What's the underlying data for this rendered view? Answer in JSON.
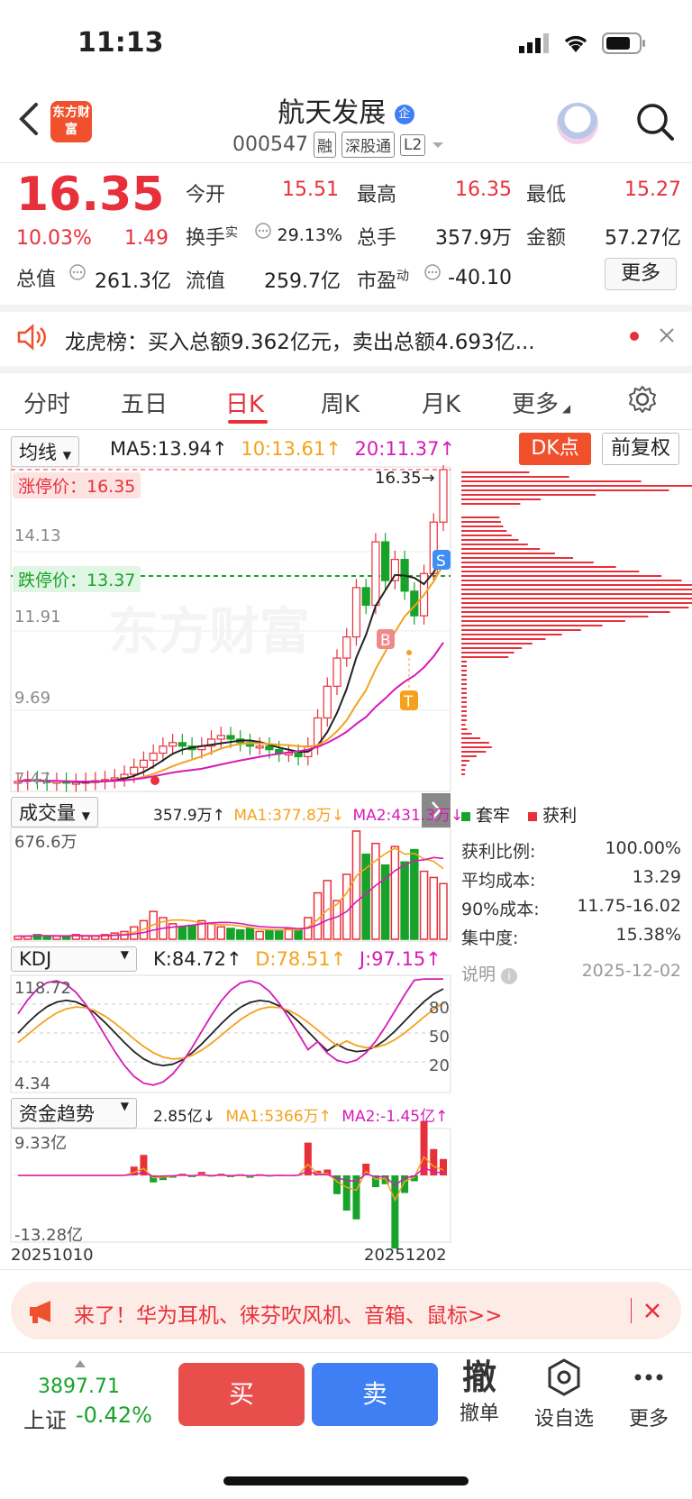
{
  "status": {
    "time": "11:13"
  },
  "header": {
    "logo_text": "东方财富",
    "stock_name": "航天发展",
    "name_badge": "企",
    "stock_code": "000547",
    "tags": [
      "融",
      "深股通",
      "L2"
    ]
  },
  "quote": {
    "price": "16.35",
    "change_pct": "10.03%",
    "change_val": "1.49",
    "cells": [
      {
        "label": "今开",
        "value": "15.51",
        "color": "red"
      },
      {
        "label": "最高",
        "value": "16.35",
        "color": "red"
      },
      {
        "label": "最低",
        "value": "15.27",
        "color": "red"
      },
      {
        "label": "换手",
        "label_sup": "实",
        "value": "29.13%",
        "color": "dark"
      },
      {
        "label": "总手",
        "value": "357.9万",
        "color": "dark"
      },
      {
        "label": "金额",
        "value": "57.27亿",
        "color": "dark"
      },
      {
        "label": "总值",
        "value": "261.3亿",
        "color": "dark"
      },
      {
        "label": "流值",
        "value": "259.7亿",
        "color": "dark"
      },
      {
        "label": "市盈",
        "label_sup": "动",
        "value": "-40.10",
        "color": "dark"
      }
    ],
    "more_label": "更多"
  },
  "notice": {
    "text": "龙虎榜：买入总额9.362亿元，卖出总额4.693亿..."
  },
  "tabs": [
    {
      "label": "分时",
      "active": false
    },
    {
      "label": "五日",
      "active": false
    },
    {
      "label": "日K",
      "active": true
    },
    {
      "label": "周K",
      "active": false
    },
    {
      "label": "月K",
      "active": false
    },
    {
      "label": "更多",
      "active": false
    }
  ],
  "kchart": {
    "indicator_select": "均线",
    "ma5": "MA5:13.94↑",
    "ma10": "10:13.61↑",
    "ma20": "20:11.37↑",
    "dk_label": "DK点",
    "adjust_label": "前复权",
    "limit_up_label": "涨停价：16.35",
    "limit_down_label": "跌停价：13.37",
    "price_axis": [
      "16.35",
      "14.13",
      "11.91",
      "9.69",
      "7.47"
    ],
    "last_price_marker": "16.35→",
    "watermark": "东方财富",
    "signal_b": "B",
    "signal_s": "S",
    "signal_t": "T"
  },
  "volume": {
    "select": "成交量",
    "value": "357.9万↑",
    "ma1": "MA1:377.8万↓",
    "ma2": "MA2:431.3万↓",
    "axis_max": "676.6万"
  },
  "kdj": {
    "select": "KDJ",
    "k": "K:84.72↑",
    "d": "D:78.51↑",
    "j": "J:97.15↑",
    "axis_max": "118.72",
    "axis_min": "4.34",
    "levels": [
      "80",
      "50",
      "20"
    ]
  },
  "fund": {
    "select": "资金趋势",
    "value": "2.85亿↓",
    "ma1": "MA1:5366万↑",
    "ma2": "MA2:-1.45亿↑",
    "axis_max": "9.33亿",
    "axis_min": "-13.28亿",
    "date_start": "20251010",
    "date_end": "20251202"
  },
  "chip_panel": {
    "legend_trapped": "套牢",
    "legend_profit": "获利",
    "rows": [
      {
        "label": "获利比例:",
        "value": "100.00%"
      },
      {
        "label": "平均成本:",
        "value": "13.29"
      },
      {
        "label": "90%成本:",
        "value": "11.75-16.02"
      },
      {
        "label": "集中度:",
        "value": "15.38%"
      }
    ],
    "note_label": "说明",
    "date": "2025-12-02"
  },
  "banner": {
    "text": "来了！华为耳机、徕芬吹风机、音箱、鼠标>>"
  },
  "bottom": {
    "index_value": "3897.71",
    "index_name": "上证",
    "index_change": "-0.42%",
    "buy": "买",
    "sell": "卖",
    "cancel_icon": "撤",
    "cancel_label": "撤单",
    "watch_label": "设自选",
    "more_label": "更多"
  },
  "colors": {
    "up": "#e8303b",
    "down": "#17a32a",
    "accent": "#f0502b"
  }
}
